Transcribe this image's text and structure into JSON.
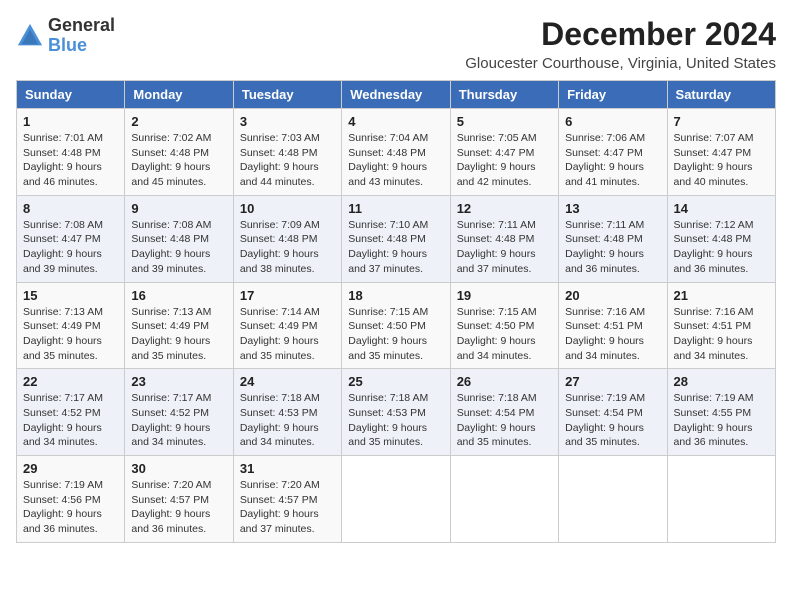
{
  "logo": {
    "general": "General",
    "blue": "Blue"
  },
  "title": "December 2024",
  "subtitle": "Gloucester Courthouse, Virginia, United States",
  "days_of_week": [
    "Sunday",
    "Monday",
    "Tuesday",
    "Wednesday",
    "Thursday",
    "Friday",
    "Saturday"
  ],
  "weeks": [
    [
      {
        "day": "1",
        "sunrise": "Sunrise: 7:01 AM",
        "sunset": "Sunset: 4:48 PM",
        "daylight": "Daylight: 9 hours and 46 minutes."
      },
      {
        "day": "2",
        "sunrise": "Sunrise: 7:02 AM",
        "sunset": "Sunset: 4:48 PM",
        "daylight": "Daylight: 9 hours and 45 minutes."
      },
      {
        "day": "3",
        "sunrise": "Sunrise: 7:03 AM",
        "sunset": "Sunset: 4:48 PM",
        "daylight": "Daylight: 9 hours and 44 minutes."
      },
      {
        "day": "4",
        "sunrise": "Sunrise: 7:04 AM",
        "sunset": "Sunset: 4:48 PM",
        "daylight": "Daylight: 9 hours and 43 minutes."
      },
      {
        "day": "5",
        "sunrise": "Sunrise: 7:05 AM",
        "sunset": "Sunset: 4:47 PM",
        "daylight": "Daylight: 9 hours and 42 minutes."
      },
      {
        "day": "6",
        "sunrise": "Sunrise: 7:06 AM",
        "sunset": "Sunset: 4:47 PM",
        "daylight": "Daylight: 9 hours and 41 minutes."
      },
      {
        "day": "7",
        "sunrise": "Sunrise: 7:07 AM",
        "sunset": "Sunset: 4:47 PM",
        "daylight": "Daylight: 9 hours and 40 minutes."
      }
    ],
    [
      {
        "day": "8",
        "sunrise": "Sunrise: 7:08 AM",
        "sunset": "Sunset: 4:47 PM",
        "daylight": "Daylight: 9 hours and 39 minutes."
      },
      {
        "day": "9",
        "sunrise": "Sunrise: 7:08 AM",
        "sunset": "Sunset: 4:48 PM",
        "daylight": "Daylight: 9 hours and 39 minutes."
      },
      {
        "day": "10",
        "sunrise": "Sunrise: 7:09 AM",
        "sunset": "Sunset: 4:48 PM",
        "daylight": "Daylight: 9 hours and 38 minutes."
      },
      {
        "day": "11",
        "sunrise": "Sunrise: 7:10 AM",
        "sunset": "Sunset: 4:48 PM",
        "daylight": "Daylight: 9 hours and 37 minutes."
      },
      {
        "day": "12",
        "sunrise": "Sunrise: 7:11 AM",
        "sunset": "Sunset: 4:48 PM",
        "daylight": "Daylight: 9 hours and 37 minutes."
      },
      {
        "day": "13",
        "sunrise": "Sunrise: 7:11 AM",
        "sunset": "Sunset: 4:48 PM",
        "daylight": "Daylight: 9 hours and 36 minutes."
      },
      {
        "day": "14",
        "sunrise": "Sunrise: 7:12 AM",
        "sunset": "Sunset: 4:48 PM",
        "daylight": "Daylight: 9 hours and 36 minutes."
      }
    ],
    [
      {
        "day": "15",
        "sunrise": "Sunrise: 7:13 AM",
        "sunset": "Sunset: 4:49 PM",
        "daylight": "Daylight: 9 hours and 35 minutes."
      },
      {
        "day": "16",
        "sunrise": "Sunrise: 7:13 AM",
        "sunset": "Sunset: 4:49 PM",
        "daylight": "Daylight: 9 hours and 35 minutes."
      },
      {
        "day": "17",
        "sunrise": "Sunrise: 7:14 AM",
        "sunset": "Sunset: 4:49 PM",
        "daylight": "Daylight: 9 hours and 35 minutes."
      },
      {
        "day": "18",
        "sunrise": "Sunrise: 7:15 AM",
        "sunset": "Sunset: 4:50 PM",
        "daylight": "Daylight: 9 hours and 35 minutes."
      },
      {
        "day": "19",
        "sunrise": "Sunrise: 7:15 AM",
        "sunset": "Sunset: 4:50 PM",
        "daylight": "Daylight: 9 hours and 34 minutes."
      },
      {
        "day": "20",
        "sunrise": "Sunrise: 7:16 AM",
        "sunset": "Sunset: 4:51 PM",
        "daylight": "Daylight: 9 hours and 34 minutes."
      },
      {
        "day": "21",
        "sunrise": "Sunrise: 7:16 AM",
        "sunset": "Sunset: 4:51 PM",
        "daylight": "Daylight: 9 hours and 34 minutes."
      }
    ],
    [
      {
        "day": "22",
        "sunrise": "Sunrise: 7:17 AM",
        "sunset": "Sunset: 4:52 PM",
        "daylight": "Daylight: 9 hours and 34 minutes."
      },
      {
        "day": "23",
        "sunrise": "Sunrise: 7:17 AM",
        "sunset": "Sunset: 4:52 PM",
        "daylight": "Daylight: 9 hours and 34 minutes."
      },
      {
        "day": "24",
        "sunrise": "Sunrise: 7:18 AM",
        "sunset": "Sunset: 4:53 PM",
        "daylight": "Daylight: 9 hours and 34 minutes."
      },
      {
        "day": "25",
        "sunrise": "Sunrise: 7:18 AM",
        "sunset": "Sunset: 4:53 PM",
        "daylight": "Daylight: 9 hours and 35 minutes."
      },
      {
        "day": "26",
        "sunrise": "Sunrise: 7:18 AM",
        "sunset": "Sunset: 4:54 PM",
        "daylight": "Daylight: 9 hours and 35 minutes."
      },
      {
        "day": "27",
        "sunrise": "Sunrise: 7:19 AM",
        "sunset": "Sunset: 4:54 PM",
        "daylight": "Daylight: 9 hours and 35 minutes."
      },
      {
        "day": "28",
        "sunrise": "Sunrise: 7:19 AM",
        "sunset": "Sunset: 4:55 PM",
        "daylight": "Daylight: 9 hours and 36 minutes."
      }
    ],
    [
      {
        "day": "29",
        "sunrise": "Sunrise: 7:19 AM",
        "sunset": "Sunset: 4:56 PM",
        "daylight": "Daylight: 9 hours and 36 minutes."
      },
      {
        "day": "30",
        "sunrise": "Sunrise: 7:20 AM",
        "sunset": "Sunset: 4:57 PM",
        "daylight": "Daylight: 9 hours and 36 minutes."
      },
      {
        "day": "31",
        "sunrise": "Sunrise: 7:20 AM",
        "sunset": "Sunset: 4:57 PM",
        "daylight": "Daylight: 9 hours and 37 minutes."
      },
      null,
      null,
      null,
      null
    ]
  ]
}
